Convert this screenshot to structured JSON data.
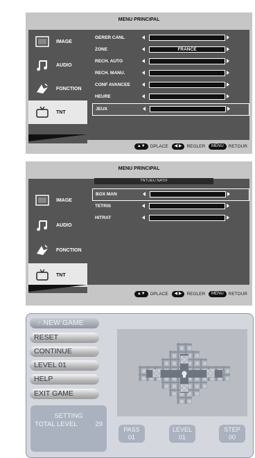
{
  "menu1": {
    "title": "MENU PRINCIPAL",
    "sidebar": [
      {
        "label": "IMAGE",
        "icon": "image-icon"
      },
      {
        "label": "AUDIO",
        "icon": "music-note-icon"
      },
      {
        "label": "FONCTION",
        "icon": "function-icon"
      },
      {
        "label": "TNT",
        "icon": "tv-icon"
      }
    ],
    "selected_sidebar": "TNT",
    "rows": [
      {
        "label": "GERER CANL",
        "value": ""
      },
      {
        "label": "ZONE",
        "value": "FRANCE"
      },
      {
        "label": "RECH. AUTO",
        "value": ""
      },
      {
        "label": "RECH. MANU.",
        "value": ""
      },
      {
        "label": "CONF AVANCEE",
        "value": ""
      },
      {
        "label": "HEURE",
        "value": ""
      },
      {
        "label": "JEUX",
        "value": ""
      }
    ],
    "selected_row": "JEUX",
    "footer": {
      "move_label": "DPLACE",
      "adjust_label": "REGLER",
      "menu_key": "MENU",
      "back_label": "RETOUR"
    }
  },
  "menu2": {
    "title": "MENU PRINCIPAL",
    "breadcrumb": "TNT\\JEU NATIF",
    "sidebar": [
      {
        "label": "IMAGE",
        "icon": "image-icon"
      },
      {
        "label": "AUDIO",
        "icon": "music-note-icon"
      },
      {
        "label": "FONCTION",
        "icon": "function-icon"
      },
      {
        "label": "TNT",
        "icon": "tv-icon"
      }
    ],
    "selected_sidebar": "TNT",
    "rows": [
      {
        "label": "BOX MAN",
        "value": ""
      },
      {
        "label": "TETRIS",
        "value": ""
      },
      {
        "label": "HITRAT",
        "value": ""
      }
    ],
    "selected_row": "BOX MAN",
    "footer": {
      "move_label": "DPLACE",
      "adjust_label": "REGLER",
      "menu_key": "MENU",
      "back_label": "RETOUR"
    }
  },
  "game": {
    "buttons": [
      "NEW GAME",
      "RESET",
      "CONTINUE",
      "LEVEL  01",
      "HELP",
      "EXIT GAME"
    ],
    "active_button": "NEW GAME",
    "setting_label": "SETTING",
    "total_level_label": "TOTAL LEVEL",
    "total_level_value": "29",
    "pass": {
      "label": "PASS",
      "value": "01"
    },
    "level": {
      "label": "LEVEL",
      "value": "01"
    },
    "step": {
      "label": "STEP",
      "value": "00"
    }
  },
  "colors": {
    "menu_bg": "#c6c6c6",
    "menu_dark": "#555555",
    "game_bg": "#d4d7dd",
    "game_panel": "#aab2bf"
  }
}
